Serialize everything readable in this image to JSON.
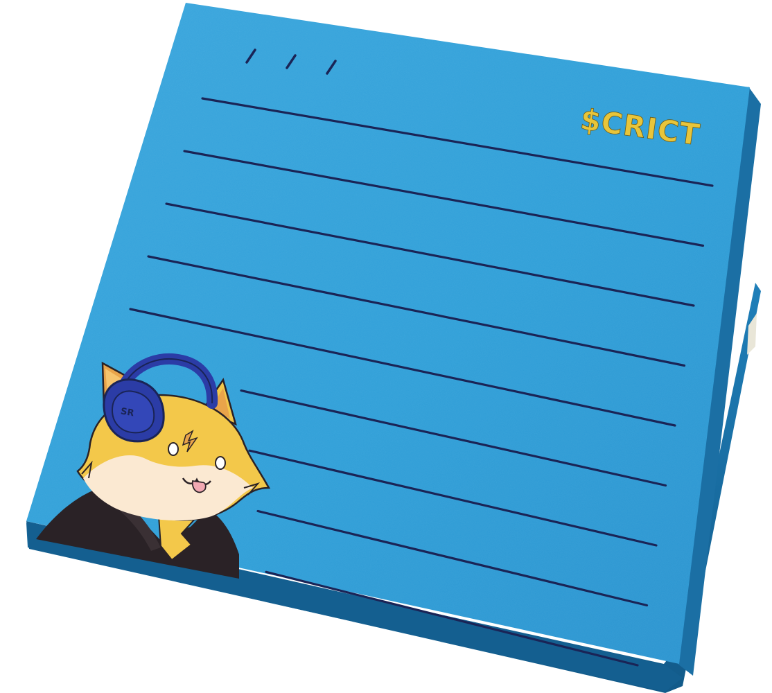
{
  "brand": {
    "logo_text": "$CRICT"
  },
  "notepad": {
    "ruled_line_count": 9,
    "top_tick_count": 3
  },
  "mascot": {
    "character": "fox-with-headphones-icon",
    "headphone_letters": "SR"
  },
  "colors": {
    "paper": "#2f9fd8",
    "paper_highlight": "#45ace0",
    "edge": "#1e78b0",
    "edge_dark": "#135e8e",
    "rule": "#1a2456",
    "logo_gold": "#e8c53a",
    "fox_yellow": "#f3c84a",
    "fox_orange": "#e9a44a",
    "fox_cream": "#fbe9d2",
    "headphone_blue": "#2b3ca6",
    "jacket": "#2a2226",
    "tongue": "#f2a9b3"
  }
}
